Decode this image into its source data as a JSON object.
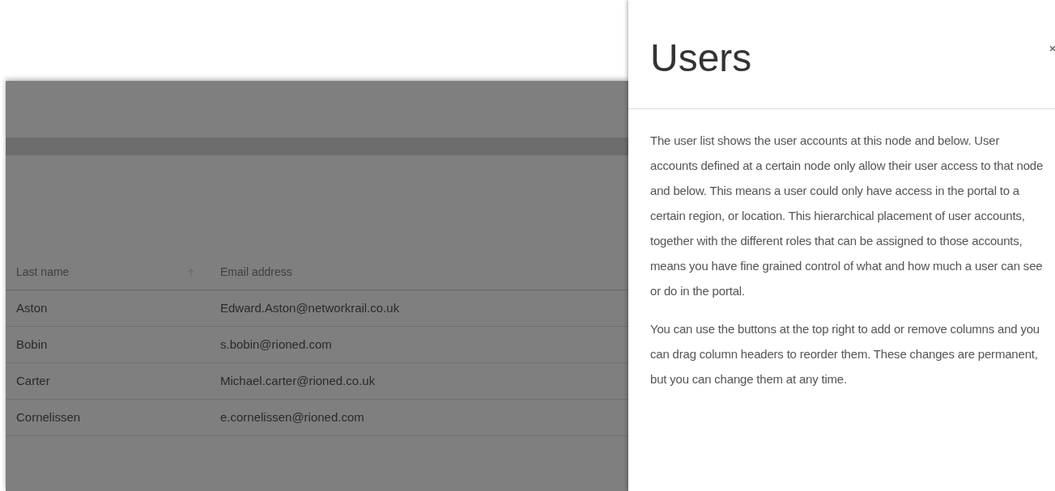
{
  "table": {
    "columns": [
      {
        "label": "Last name",
        "sorted": true
      },
      {
        "label": "Email address",
        "sorted": false
      }
    ],
    "rows": [
      [
        "Aston",
        "Edward.Aston@networkrail.co.uk"
      ],
      [
        "Bobin",
        "s.bobin@rioned.com"
      ],
      [
        "Carter",
        "Michael.carter@rioned.co.uk"
      ],
      [
        "Cornelissen",
        "e.cornelissen@rioned.com"
      ]
    ]
  },
  "help_panel": {
    "title": "Users",
    "paragraphs": [
      "The user list shows the user accounts at this node and below. User accounts defined at a certain node only allow their user access to that node and below. This means a user could only have access in the portal to a certain region, or location. This hierarchical placement of user accounts, together with the different roles that can be assigned to those accounts, means you have fine grained control of what and how much a user can see or do in the portal.",
      "You can use the buttons at the top right to add or remove columns and you can drag column headers to reorder them. These changes are permanent, but you can change them at any time."
    ]
  }
}
